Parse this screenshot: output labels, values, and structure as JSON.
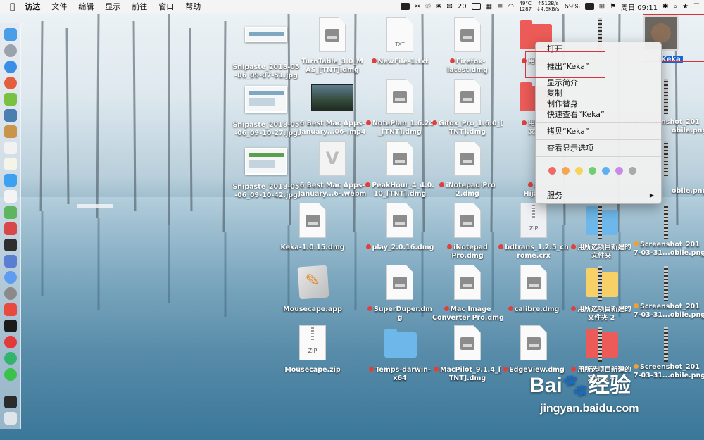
{
  "menubar": {
    "apple": "",
    "items": [
      "访达",
      "文件",
      "编辑",
      "显示",
      "前往",
      "窗口",
      "帮助"
    ],
    "status": {
      "wechat_count": "20",
      "temp": "49°C",
      "fan": "1287",
      "net_up": "↑512B/s",
      "net_down": "↓4.6KB/s",
      "battery": "69%",
      "date": "周日 09:11"
    }
  },
  "desktop": {
    "col1": [
      {
        "label": "Snipaste_2018-05",
        "label2": "-06_09-07-51.jpg"
      },
      {
        "label": "Snipaste_2018-05",
        "label2": "-06_09-10-27.jpg"
      },
      {
        "label": "Snipaste_2018-05",
        "label2": "-06_09-10-42.jpg"
      },
      {
        "label": "Keka-1.0.15.dmg",
        "label2": ""
      },
      {
        "label": "Mousecape.app",
        "label2": ""
      },
      {
        "label": "Mousecape.zip",
        "label2": ""
      }
    ],
    "col2": [
      {
        "label": "TurnTable_3.0_M",
        "label2": "AS_[TNT].dmg"
      },
      {
        "label": "6 Best Mac Apps-",
        "label2": "January...06-.mp4"
      },
      {
        "label": "6 Best Mac Apps-",
        "label2": "January...6-.webm"
      },
      {
        "label": "play_2.0.16.dmg",
        "label2": ""
      },
      {
        "label": "SuperDuper.dm",
        "label2": "g"
      },
      {
        "label": "Temps-darwin-",
        "label2": "x64"
      }
    ],
    "col3": [
      {
        "label": "NewFile-1.txt",
        "label2": ""
      },
      {
        "label": "NotePlan_1.6.24",
        "label2": "_[TNT].dmg"
      },
      {
        "label": "PeakHour_4_4.0.",
        "label2": "10_[TNT].dmg"
      },
      {
        "label": "iNotepad",
        "label2": "Pro.dmg"
      },
      {
        "label": "Mac Image",
        "label2": "Converter Pro.dmg"
      },
      {
        "label": "MacPilot_9.1.4_[",
        "label2": "TNT].dmg"
      }
    ],
    "col4": [
      {
        "label": "Firefox-",
        "label2": "latest.dmg"
      },
      {
        "label": "Gifox_Pro_1.6.0_[",
        "label2": "TNT].dmg"
      },
      {
        "label": "iNotepad Pro",
        "label2": "2.dmg"
      },
      {
        "label": "bdtrans_1.2.5_ch",
        "label2": "rome.crx"
      },
      {
        "label": "calibre.dmg",
        "label2": ""
      },
      {
        "label": "EdgeView.dmg",
        "label2": ""
      }
    ],
    "col5": [
      {
        "label": "用所选项目新建的",
        "label2": "文件夹"
      },
      {
        "label": "用所选项目新建的",
        "label2": "文件夹 2"
      },
      {
        "label": "用所选项目新建的",
        "label2": "文件夹 4"
      }
    ],
    "col6": [
      {
        "label": "Screenshot_201",
        "label2": "7-03-31...obile.png"
      },
      {
        "label": "Screenshot_201",
        "label2": "7-03-31...obile.png"
      },
      {
        "label": "Screenshot_201",
        "label2": "7-03-31...obile.png"
      }
    ],
    "partial": {
      "a": "用所选",
      "b": "用所选",
      "b2": "文件",
      "c": "Screenshot_201",
      "c2": "obile.png",
      "d": "Al",
      "d2": "Hijack",
      "e": "obile.png"
    },
    "selected": {
      "label": "Keka"
    }
  },
  "context_menu": {
    "open": "打开",
    "eject": "推出“Keka”",
    "get_info": "显示简介",
    "duplicate": "复制",
    "make_alias": "制作替身",
    "quick_look": "快速查看“Keka”",
    "copy": "拷贝“Keka”",
    "view_options": "查看显示选项",
    "services": "服务",
    "tags": [
      "#ef6a68",
      "#f3a752",
      "#f5d45a",
      "#6fcf71",
      "#5fb0f1",
      "#c98ae6",
      "#a9a9a9"
    ]
  },
  "watermark": {
    "brand": "Bai",
    "brand2": "经验",
    "url": "jingyan.baidu.com"
  }
}
